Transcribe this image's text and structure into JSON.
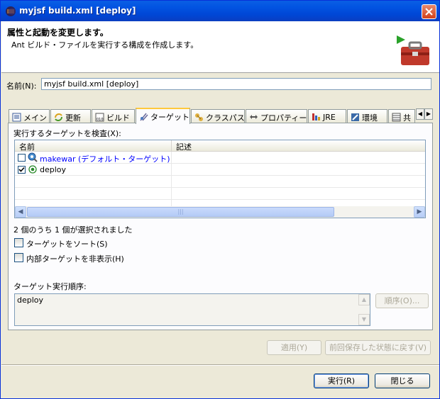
{
  "window": {
    "title": "myjsf build.xml [deploy]"
  },
  "header": {
    "title": "属性と起動を変更します。",
    "description": "Ant ビルド・ファイルを実行する構成を作成します。"
  },
  "name_field": {
    "label": "名前(N):",
    "value": "myjsf build.xml [deploy]"
  },
  "tabs": [
    {
      "label": "メイン",
      "icon": "main-icon"
    },
    {
      "label": "更新",
      "icon": "refresh-icon"
    },
    {
      "label": "ビルド",
      "icon": "build-icon"
    },
    {
      "label": "ターゲット",
      "icon": "targets-icon",
      "active": true
    },
    {
      "label": "クラスパス",
      "icon": "classpath-icon"
    },
    {
      "label": "プロパティー",
      "icon": "properties-icon"
    },
    {
      "label": "JRE",
      "icon": "jre-icon"
    },
    {
      "label": "環境",
      "icon": "environment-icon"
    },
    {
      "label": "共",
      "icon": "common-icon"
    }
  ],
  "targets_panel": {
    "check_label": "実行するターゲットを検査(X):",
    "columns": [
      "名前",
      "記述"
    ],
    "rows": [
      {
        "name": "makewar (デフォルト・ターゲット)",
        "description": "",
        "checked": false,
        "default": true
      },
      {
        "name": "deploy",
        "description": "",
        "checked": true,
        "default": false
      }
    ],
    "scroll_thumb_label": "|||",
    "selection_status": "2 個のうち 1 個が選択されました",
    "sort_label": "ターゲットをソート(S)",
    "sort_checked": false,
    "hide_internal_label": "内部ターゲットを非表示(H)",
    "hide_internal_checked": false,
    "order_label": "ターゲット実行順序:",
    "order_value": "deploy",
    "order_button": "順序(O)..."
  },
  "buttons": {
    "apply": "適用(Y)",
    "revert": "前回保存した状態に戻す(V)",
    "run": "実行(R)",
    "close": "閉じる"
  },
  "colors": {
    "titlebar": "#0054e3",
    "close": "#d1411b",
    "link": "#0000ff"
  }
}
